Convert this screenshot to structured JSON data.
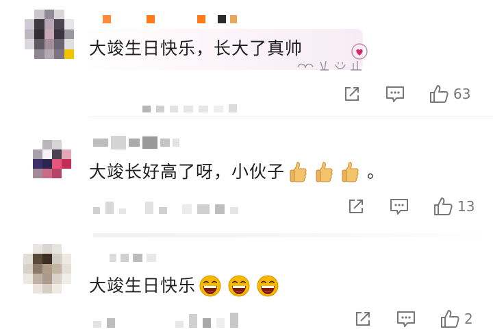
{
  "comments": [
    {
      "text": "大竣生日快乐，长大了真帅",
      "likes": "63",
      "emoji": [],
      "trailing": ""
    },
    {
      "text": "大竣长好高了呀，小伙子",
      "likes": "13",
      "emoji": [
        "thumbs-up-emoji",
        "thumbs-up-emoji",
        "thumbs-up-emoji"
      ],
      "trailing": "。"
    },
    {
      "text": "大竣生日快乐",
      "likes": "2",
      "emoji": [
        "laughing-emoji",
        "laughing-emoji",
        "laughing-emoji"
      ],
      "trailing": ""
    }
  ],
  "colors": {
    "icon": "#777777",
    "text": "#1f1f1f",
    "thumb_yellow": "#f3c46a",
    "laugh_yellow": "#f7b800",
    "badge_orange": "#ff7a1a"
  },
  "icons": [
    "share-icon",
    "comment-icon",
    "like-icon"
  ]
}
